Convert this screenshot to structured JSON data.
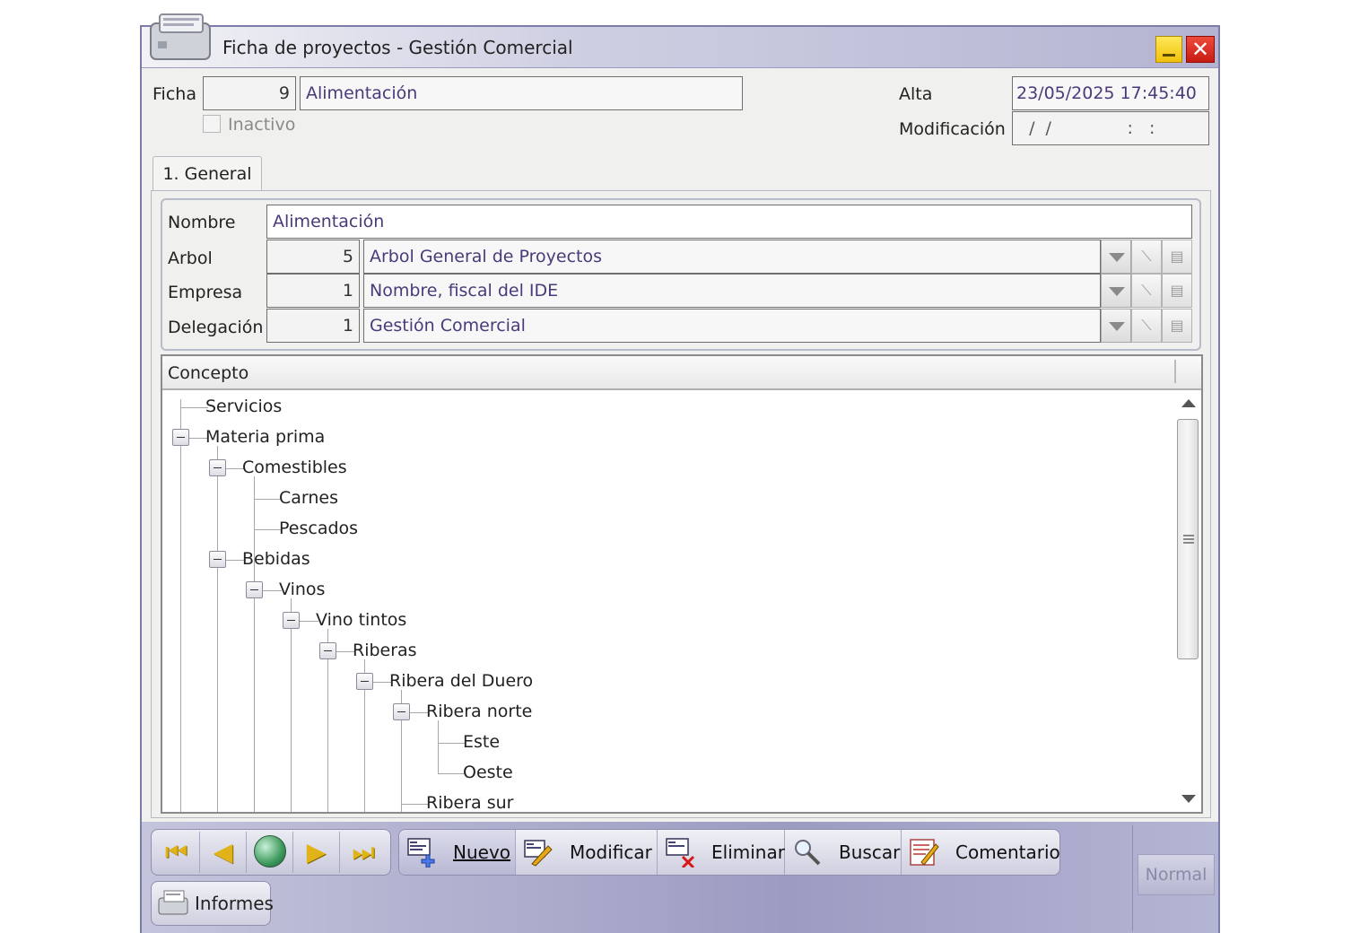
{
  "window": {
    "title": "Ficha de proyectos - Gestión Comercial",
    "minimize_icon": "minimize-icon",
    "close_icon": "close-icon"
  },
  "header": {
    "ficha_label": "Ficha",
    "ficha_number": "9",
    "ficha_name": "Alimentación",
    "inactivo_label": "Inactivo",
    "inactivo_checked": false,
    "alta_label": "Alta",
    "alta_value": "23/05/2025  17:45:40",
    "modificacion_label": "Modificación",
    "modificacion_value": "  /  /              :   :"
  },
  "tabs": [
    {
      "label": "1. General",
      "active": true
    }
  ],
  "general": {
    "nombre_label": "Nombre",
    "nombre_value": "Alimentación",
    "arbol_label": "Arbol",
    "arbol_code": "5",
    "arbol_value": "Arbol General de Proyectos",
    "empresa_label": "Empresa",
    "empresa_code": "1",
    "empresa_value": "Nombre, fiscal del IDE",
    "delegacion_label": "Delegación",
    "delegacion_code": "1",
    "delegacion_value": "Gestión Comercial"
  },
  "tree": {
    "column_header": "Concepto",
    "nodes": [
      {
        "label": "Servicios",
        "level": 0,
        "expanded": null
      },
      {
        "label": "Materia prima",
        "level": 0,
        "expanded": true
      },
      {
        "label": "Comestibles",
        "level": 1,
        "expanded": true
      },
      {
        "label": "Carnes",
        "level": 2,
        "expanded": null
      },
      {
        "label": "Pescados",
        "level": 2,
        "expanded": null
      },
      {
        "label": "Bebidas",
        "level": 1,
        "expanded": true
      },
      {
        "label": "Vinos",
        "level": 2,
        "expanded": true
      },
      {
        "label": "Vino tintos",
        "level": 3,
        "expanded": true
      },
      {
        "label": "Riberas",
        "level": 4,
        "expanded": true
      },
      {
        "label": "Ribera del Duero",
        "level": 5,
        "expanded": true
      },
      {
        "label": "Ribera norte",
        "level": 6,
        "expanded": true
      },
      {
        "label": "Este",
        "level": 7,
        "expanded": null
      },
      {
        "label": "Oeste",
        "level": 7,
        "expanded": null
      },
      {
        "label": "Ribera sur",
        "level": 6,
        "expanded": null
      }
    ]
  },
  "toolbar": {
    "nav_first_icon": "first-record-icon",
    "nav_prev_icon": "previous-record-icon",
    "nav_globe_icon": "globe-icon",
    "nav_next_icon": "next-record-icon",
    "nav_last_icon": "last-record-icon",
    "nuevo": "Nuevo",
    "modificar": "Modificar",
    "eliminar": "Eliminar",
    "buscar": "Buscar",
    "comentario": "Comentario",
    "informes": "Informes",
    "normal": "Normal"
  }
}
